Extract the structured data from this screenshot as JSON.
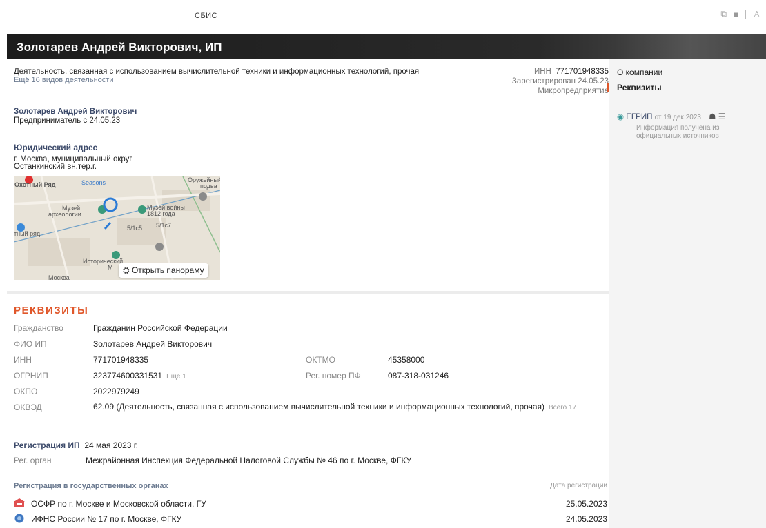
{
  "app": {
    "brand": "СБИС"
  },
  "header": {
    "title": "Золотарев Андрей Викторович, ИП"
  },
  "summary": {
    "activity": "Деятельность, связанная с использованием вычислительной техники и информационных технологий, прочая",
    "more_activities": "Ещё 16 видов деятельности",
    "inn_label": "ИНН",
    "inn_value": "771701948335",
    "registered": "Зарегистрирован 24.05.23",
    "size": "Микропредприятие",
    "owner_name": "Золотарев Андрей Викторович",
    "owner_role": "Предприниматель с 24.05.23"
  },
  "address": {
    "title": "Юридический адрес",
    "line1": "г. Москва, муниципальный округ",
    "line2": "Останкинский вн.тер.г."
  },
  "map": {
    "labels": [
      "Охотный Ряд",
      "Seasons",
      "Оружейный",
      "подва",
      "Музей",
      "археологии",
      "Музей войны",
      "1812 года",
      "5/1с5",
      "5/1с7",
      "тный ряд",
      "Исторический",
      "М",
      "Москва"
    ],
    "panorama_button": "Открыть панораму"
  },
  "requisites": {
    "title": "РЕКВИЗИТЫ",
    "citizenship_label": "Гражданство",
    "citizenship_value": "Гражданин Российской Федерации",
    "fio_label": "ФИО ИП",
    "fio_value": "Золотарев Андрей Викторович",
    "inn_label": "ИНН",
    "inn_value": "771701948335",
    "oktmo_label": "ОКТМО",
    "oktmo_value": "45358000",
    "ogrnip_label": "ОГРНИП",
    "ogrnip_value": "323774600331531",
    "ogrnip_more": "Еще 1",
    "pf_label": "Рег. номер ПФ",
    "pf_value": "087-318-031246",
    "okpo_label": "ОКПО",
    "okpo_value": "2022979249",
    "okved_label": "ОКВЭД",
    "okved_value": "62.09 (Деятельность, связанная с использованием вычислительной техники и информационных технологий, прочая)",
    "okved_total": "Всего 17"
  },
  "registration": {
    "title": "Регистрация ИП",
    "date": "24 мая 2023 г.",
    "organ_label": "Рег. орган",
    "organ_value": "Межрайонная Инспекция Федеральной Налоговой Службы № 46 по г. Москве, ФГКУ"
  },
  "gov": {
    "title": "Регистрация в государственных органах",
    "date_header": "Дата регистрации",
    "rows": [
      {
        "name": "ОСФР по г. Москве и Московской области, ГУ",
        "date": "25.05.2023"
      },
      {
        "name": "ИФНС России № 17 по г. Москве, ФГКУ",
        "date": "24.05.2023"
      }
    ]
  },
  "nav": {
    "about": "О компании",
    "requisites": "Реквизиты"
  },
  "source": {
    "name": "ЕГРИП",
    "date": "от 19 дек 2023",
    "note": "Информация получена из официальных источников"
  },
  "colors": {
    "accent": "#e0572a",
    "link": "#3c4a6a",
    "muted": "#888888"
  }
}
